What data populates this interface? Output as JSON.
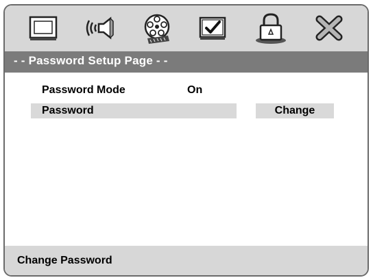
{
  "icon_bar": {
    "icons": [
      "general-setup-icon",
      "audio-setup-icon",
      "video-setup-icon",
      "preference-icon",
      "password-lock-icon",
      "exit-icon"
    ]
  },
  "page_title": "- - Password Setup Page - -",
  "rows": {
    "password_mode_label": "Password Mode",
    "password_mode_value": "On",
    "password_label": "Password",
    "change_label": "Change"
  },
  "status_text": "Change Password",
  "colors": {
    "icon_bar_bg": "#d7d7d7",
    "title_bar_bg": "#7b7b7b",
    "highlight_bg": "#d9d9d9",
    "frame_border": "#6a6a6a"
  }
}
